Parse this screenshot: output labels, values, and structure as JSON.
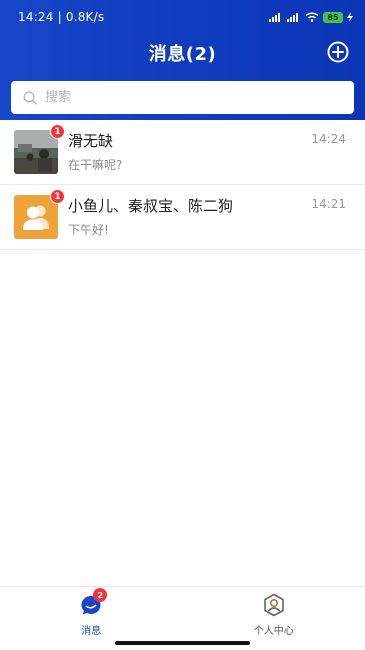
{
  "status_bar": {
    "time_speed": "14:24 | 0.8K/s",
    "battery": "85"
  },
  "header": {
    "title": "消息(2)",
    "add_icon": "plus-circle-icon"
  },
  "search": {
    "placeholder": "搜索",
    "icon": "search-icon"
  },
  "conversations": [
    {
      "name": "滑无缺",
      "last_message": "在干嘛呢?",
      "time": "14:24",
      "unread": "1",
      "avatar": "photo"
    },
    {
      "name": "小鱼儿、秦叔宝、陈二狗",
      "last_message": "下午好!",
      "time": "14:21",
      "unread": "1",
      "avatar": "group-users-icon"
    }
  ],
  "tabbar": {
    "items": [
      {
        "label": "消息",
        "badge": "2",
        "icon": "chat-bubble-icon",
        "active": true
      },
      {
        "label": "个人中心",
        "icon": "user-hexagon-icon",
        "active": false
      }
    ]
  },
  "colors": {
    "header_blue": "#1746c8",
    "badge_red": "#f2353a",
    "group_avatar_orange": "#f0a23a",
    "active_tab": "#1a46c9"
  }
}
